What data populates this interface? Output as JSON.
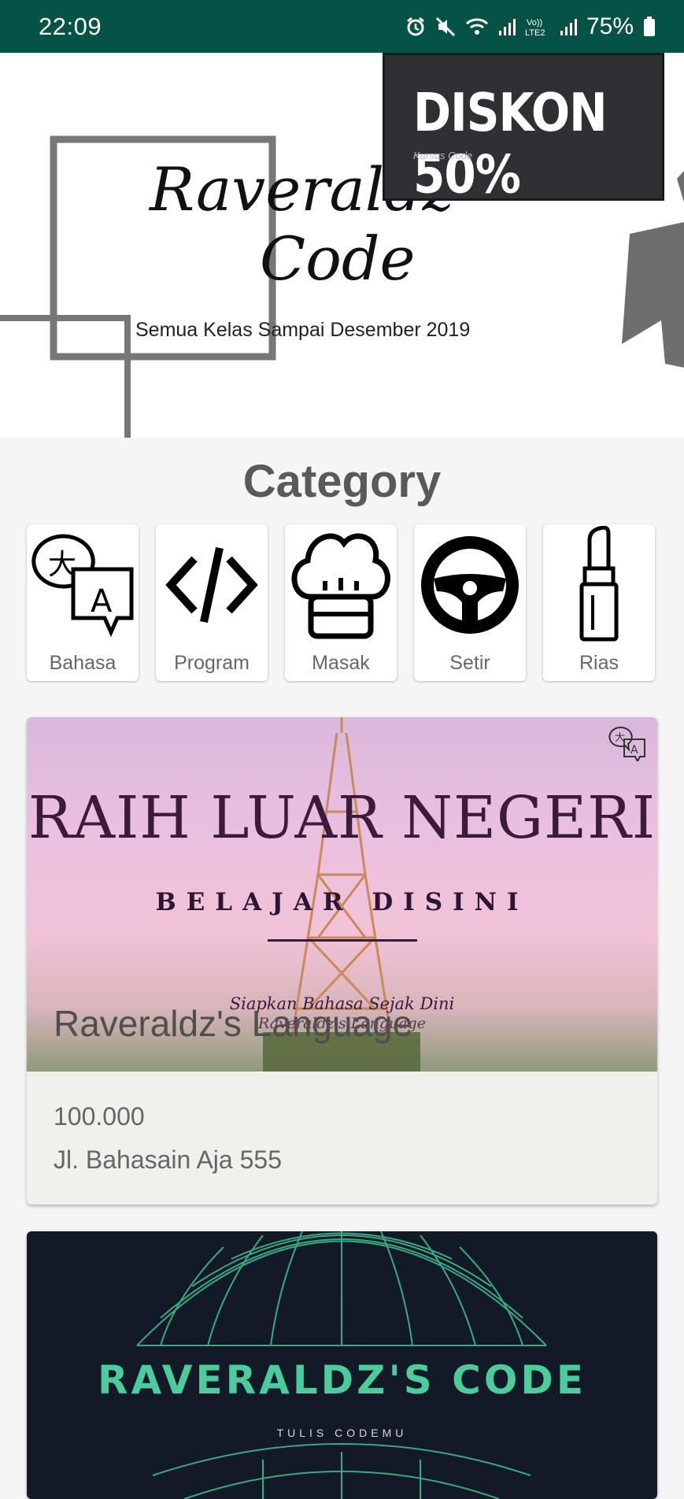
{
  "status_bar": {
    "time": "22:09",
    "battery": "75%",
    "network_label": "Vo) LTE2"
  },
  "banner": {
    "title_line1": "Raveraldz",
    "title_line2": "Code",
    "subtitle": "Semua Kelas Sampai Desember 2019",
    "promo_title": "DISKON 50%",
    "promo_subtitle": "Kursus Code"
  },
  "category": {
    "heading": "Category",
    "items": [
      {
        "label": "Bahasa",
        "icon": "translate-icon"
      },
      {
        "label": "Program",
        "icon": "code-icon"
      },
      {
        "label": "Masak",
        "icon": "chef-hat-icon"
      },
      {
        "label": "Setir",
        "icon": "steering-wheel-icon"
      },
      {
        "label": "Rias",
        "icon": "lipstick-icon"
      }
    ]
  },
  "courses": [
    {
      "image_headline": "RAIH LUAR NEGERI",
      "image_subheadline": "BELAJAR DISINI",
      "image_tagline": "Siapkan Bahasa Sejak Dini",
      "image_tagline2": "Raveraldz's Language",
      "name": "Raveraldz's Language",
      "price": "100.000",
      "address": "Jl. Bahasain Aja 555",
      "badge_icon": "translate-icon"
    },
    {
      "image_headline": "RAVERALDZ'S CODE",
      "image_subheadline": "TULIS CODEMU"
    }
  ],
  "colors": {
    "status_bar": "#045346",
    "accent_green": "#4ccc9c",
    "heading_gray": "#5a5a5a"
  }
}
